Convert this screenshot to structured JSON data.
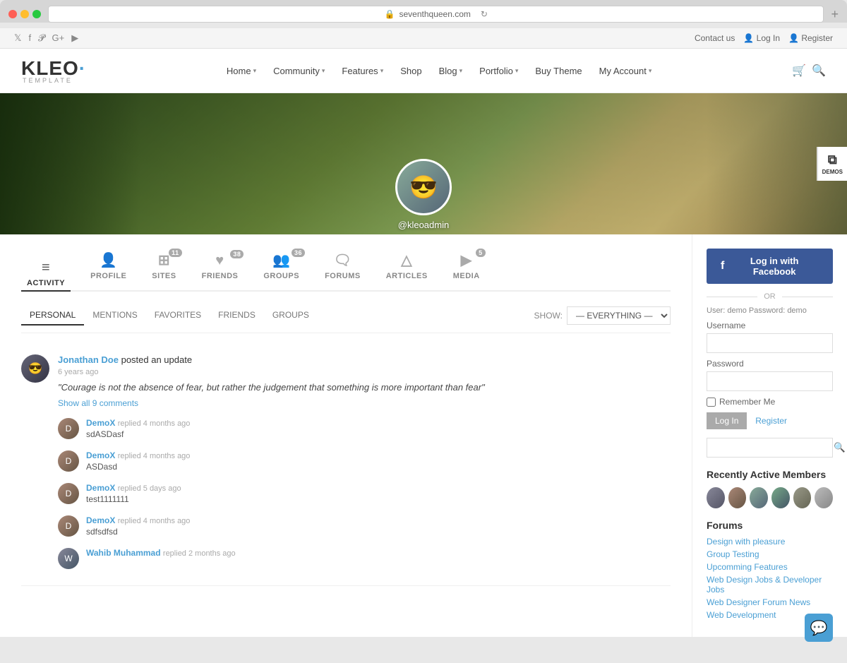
{
  "browser": {
    "url": "seventhqueen.com",
    "dots": [
      "red",
      "yellow",
      "green"
    ]
  },
  "topbar": {
    "contact": "Contact us",
    "login": "Log In",
    "register": "Register",
    "socials": [
      "twitter",
      "facebook",
      "pinterest",
      "google-plus",
      "youtube"
    ]
  },
  "nav": {
    "logo": "KLEO",
    "logo_dot_color": "#4a9fd4",
    "logo_sub": "TEMPLATE",
    "items": [
      {
        "label": "Home",
        "has_dropdown": true
      },
      {
        "label": "Community",
        "has_dropdown": true
      },
      {
        "label": "Features",
        "has_dropdown": true
      },
      {
        "label": "Shop",
        "has_dropdown": false
      },
      {
        "label": "Blog",
        "has_dropdown": true
      },
      {
        "label": "Portfolio",
        "has_dropdown": true
      },
      {
        "label": "Buy Theme",
        "has_dropdown": false
      },
      {
        "label": "My Account",
        "has_dropdown": true
      }
    ]
  },
  "hero": {
    "username": "@kleoadmin",
    "demos_label": "DEMOS"
  },
  "profile_tabs": [
    {
      "id": "activity",
      "label": "ACTIVITY",
      "icon": "≡",
      "badge": null,
      "active": true
    },
    {
      "id": "profile",
      "label": "PROFILE",
      "icon": "👤",
      "badge": null,
      "active": false
    },
    {
      "id": "sites",
      "label": "SITES",
      "icon": "⊞",
      "badge": "11",
      "active": false
    },
    {
      "id": "friends",
      "label": "FRIENDS",
      "icon": "♥",
      "badge": "38",
      "active": false
    },
    {
      "id": "groups",
      "label": "GROUPS",
      "icon": "👥",
      "badge": "36",
      "active": false
    },
    {
      "id": "forums",
      "label": "FORUMS",
      "icon": "🗨",
      "badge": null,
      "active": false
    },
    {
      "id": "articles",
      "label": "ARTICLES",
      "icon": "△",
      "badge": null,
      "active": false
    },
    {
      "id": "media",
      "label": "MEDIA",
      "icon": "▶",
      "badge": "5",
      "active": false
    }
  ],
  "activity_filter": {
    "tabs": [
      "PERSONAL",
      "MENTIONS",
      "FAVORITES",
      "FRIENDS",
      "GROUPS"
    ],
    "active_tab": "PERSONAL",
    "show_label": "SHOW:",
    "show_value": "— EVERYTHING —"
  },
  "activity_items": [
    {
      "id": "main-post",
      "author": "Jonathan Doe",
      "action": "posted an update",
      "time": "6 years ago",
      "quote": "\"Courage is not the absence of fear, but rather the judgement that something is more important than fear\"",
      "show_comments_label": "Show all 9 comments",
      "comments": [
        {
          "author": "DemoX",
          "action": "replied",
          "time": "4 months ago",
          "text": "sdASDasf"
        },
        {
          "author": "DemoX",
          "action": "replied",
          "time": "4 months ago",
          "text": "ASDasd"
        },
        {
          "author": "DemoX",
          "action": "replied",
          "time": "5 days ago",
          "text": "test1111111"
        },
        {
          "author": "DemoX",
          "action": "replied",
          "time": "4 months ago",
          "text": "sdfsdfsd"
        },
        {
          "author": "Wahib Muhammad",
          "action": "replied",
          "time": "2 months ago",
          "text": ""
        }
      ]
    }
  ],
  "sidebar": {
    "fb_login_label": "Log in with Facebook",
    "divider_label": "OR",
    "demo_hint": "User: demo Password: demo",
    "username_label": "Username",
    "password_label": "Password",
    "remember_label": "Remember Me",
    "login_btn_label": "Log In",
    "register_label": "Register",
    "recently_active_title": "Recently Active Members",
    "members": [
      "m1",
      "m2",
      "m3",
      "m4",
      "m5",
      "m6"
    ],
    "forums_title": "Forums",
    "forum_links": [
      "Design with pleasure",
      "Group Testing",
      "Upcomming Features",
      "Web Design Jobs & Developer Jobs",
      "Web Designer Forum News",
      "Web Development"
    ]
  }
}
